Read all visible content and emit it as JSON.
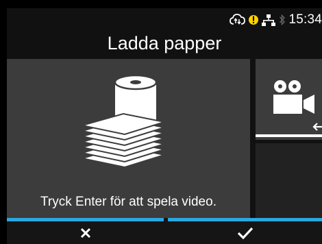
{
  "status": {
    "time": "15:34",
    "icons": [
      "cloud-sync-icon",
      "warning-icon",
      "network-icon",
      "bluetooth-icon"
    ],
    "warning_color": "#ffd200"
  },
  "title": "Ladda papper",
  "main": {
    "icon": "paper-roll-stack-icon",
    "hint": "Tryck Enter för att spela video."
  },
  "side": {
    "icon": "video-camera-icon"
  },
  "softkeys": {
    "cancel_icon": "close-icon",
    "confirm_icon": "check-icon"
  },
  "colors": {
    "accent": "#2aa7e0",
    "tile": "#3c3c3c"
  }
}
